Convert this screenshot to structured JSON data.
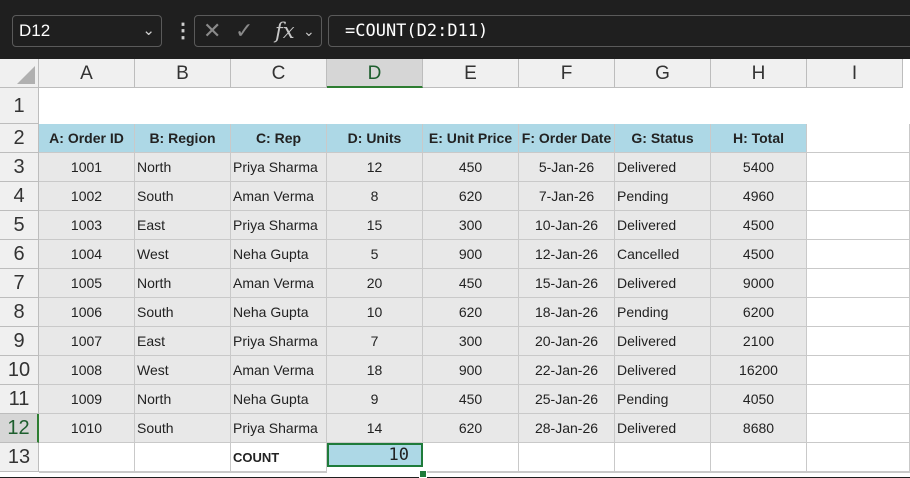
{
  "formula_bar": {
    "name_box": "D12",
    "formula": "=COUNT(D2:D11)",
    "cancel_icon": "x-icon",
    "enter_icon": "check-icon",
    "function_icon": "fx-icon"
  },
  "sheet": {
    "columns": [
      "A",
      "B",
      "C",
      "D",
      "E",
      "F",
      "G",
      "H",
      "I"
    ],
    "selected_column": "D",
    "rows": [
      "1",
      "2",
      "3",
      "4",
      "5",
      "6",
      "7",
      "8",
      "9",
      "10",
      "11",
      "12",
      "13"
    ],
    "selected_row": "12",
    "header_row": [
      "A: Order ID",
      "B: Region",
      "C: Rep",
      "D: Units",
      "E: Unit Price",
      "F: Order Date",
      "G: Status",
      "H: Total"
    ],
    "data": [
      [
        "1001",
        "North",
        "Priya Sharma",
        "12",
        "450",
        "5-Jan-26",
        "Delivered",
        "5400"
      ],
      [
        "1002",
        "South",
        "Aman Verma",
        "8",
        "620",
        "7-Jan-26",
        "Pending",
        "4960"
      ],
      [
        "1003",
        "East",
        "Priya Sharma",
        "15",
        "300",
        "10-Jan-26",
        "Delivered",
        "4500"
      ],
      [
        "1004",
        "West",
        "Neha Gupta",
        "5",
        "900",
        "12-Jan-26",
        "Cancelled",
        "4500"
      ],
      [
        "1005",
        "North",
        "Aman Verma",
        "20",
        "450",
        "15-Jan-26",
        "Delivered",
        "9000"
      ],
      [
        "1006",
        "South",
        "Neha Gupta",
        "10",
        "620",
        "18-Jan-26",
        "Pending",
        "6200"
      ],
      [
        "1007",
        "East",
        "Priya Sharma",
        "7",
        "300",
        "20-Jan-26",
        "Delivered",
        "2100"
      ],
      [
        "1008",
        "West",
        "Aman Verma",
        "18",
        "900",
        "22-Jan-26",
        "Delivered",
        "16200"
      ],
      [
        "1009",
        "North",
        "Neha Gupta",
        "9",
        "450",
        "25-Jan-26",
        "Pending",
        "4050"
      ],
      [
        "1010",
        "South",
        "Priya Sharma",
        "14",
        "620",
        "28-Jan-26",
        "Delivered",
        "8680"
      ]
    ],
    "count_label": "COUNT",
    "count_value": "10",
    "colors": {
      "header_fill": "#add8e6",
      "body_fill": "#e8e8e8",
      "selection": "#1e7b3a"
    }
  }
}
